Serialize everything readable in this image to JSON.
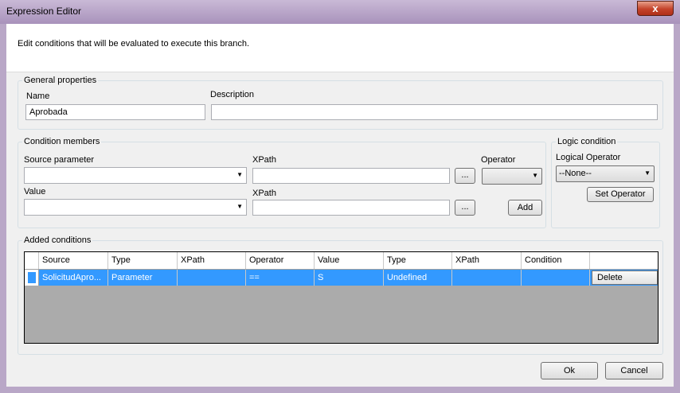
{
  "window": {
    "title": "Expression Editor",
    "close_label": "x"
  },
  "banner": {
    "text": "Edit conditions that will be evaluated to execute this branch."
  },
  "general": {
    "group_label": "General properties",
    "name_label": "Name",
    "name_value": "Aprobada",
    "description_label": "Description",
    "description_value": ""
  },
  "members": {
    "group_label": "Condition members",
    "source_label": "Source parameter",
    "source_value": "",
    "xpath1_label": "XPath",
    "xpath1_value": "",
    "operator_label": "Operator",
    "operator_value": "",
    "value_label": "Value",
    "value_value": "",
    "xpath2_label": "XPath",
    "xpath2_value": "",
    "browse_label": "...",
    "add_label": "Add"
  },
  "logic": {
    "group_label": "Logic condition",
    "logical_operator_label": "Logical Operator",
    "logical_operator_value": "--None--",
    "set_operator_label": "Set Operator"
  },
  "added": {
    "group_label": "Added conditions",
    "columns": [
      "Source",
      "Type",
      "XPath",
      "Operator",
      "Value",
      "Type",
      "XPath",
      "Condition"
    ],
    "rows": [
      {
        "source": "SolicitudApro...",
        "type": "Parameter",
        "xpath": "",
        "operator": "==",
        "value": "S",
        "type2": "Undefined",
        "xpath2": "",
        "condition": "",
        "action": "Delete"
      }
    ]
  },
  "footer": {
    "ok_label": "Ok",
    "cancel_label": "Cancel"
  }
}
